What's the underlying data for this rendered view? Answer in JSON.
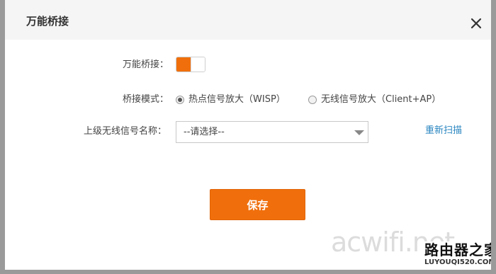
{
  "dialog": {
    "title": "万能桥接"
  },
  "form": {
    "bridge_label": "万能桥接：",
    "bridge_enabled": true,
    "mode_label": "桥接模式：",
    "modes": [
      {
        "label": "热点信号放大（WISP）",
        "checked": true
      },
      {
        "label": "无线信号放大（Client+AP）",
        "checked": false
      }
    ],
    "ssid_label": "上级无线信号名称：",
    "ssid_select_value": "--请选择--",
    "rescan_label": "重新扫描",
    "save_label": "保存"
  },
  "watermark": {
    "site_text": "acwifi.net",
    "logo_cn": "路由器之家",
    "logo_url": "LUYOUQI520.COM"
  },
  "colors": {
    "accent": "#f06f0c",
    "link": "#2a86c0",
    "header_bg": "#f5f5f5"
  },
  "icons": {
    "close": "close-icon",
    "dropdown": "chevron-down-icon"
  }
}
